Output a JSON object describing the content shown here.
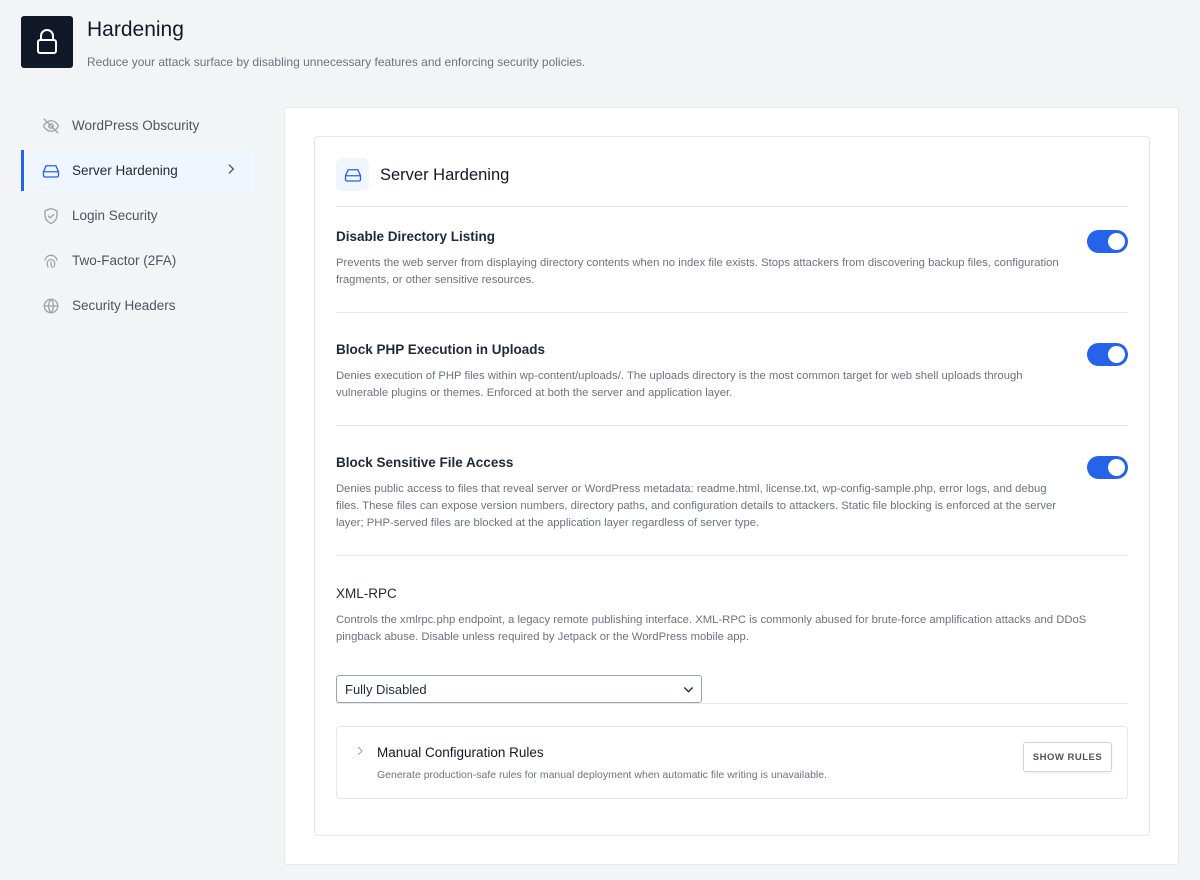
{
  "header": {
    "title": "Hardening",
    "subtitle": "Reduce your attack surface by disabling unnecessary features and enforcing security policies.",
    "logo_icon": "lock-icon"
  },
  "sidebar": {
    "items": [
      {
        "label": "WordPress Obscurity",
        "icon": "eye-slash-icon",
        "active": false
      },
      {
        "label": "Server Hardening",
        "icon": "hard-drive-icon",
        "active": true
      },
      {
        "label": "Login Security",
        "icon": "shield-check-icon",
        "active": false
      },
      {
        "label": "Two-Factor (2FA)",
        "icon": "fingerprint-icon",
        "active": false
      },
      {
        "label": "Security Headers",
        "icon": "globe-icon",
        "active": false
      }
    ]
  },
  "card": {
    "title": "Server Hardening",
    "icon": "hard-drive-icon"
  },
  "settings": [
    {
      "title": "Disable Directory Listing",
      "description": "Prevents the web server from displaying directory contents when no index file exists. Stops attackers from discovering backup files, configuration fragments, or other sensitive resources.",
      "enabled": true
    },
    {
      "title": "Block PHP Execution in Uploads",
      "description": "Denies execution of PHP files within wp-content/uploads/. The uploads directory is the most common target for web shell uploads through vulnerable plugins or themes. Enforced at both the server and application layer.",
      "enabled": true
    },
    {
      "title": "Block Sensitive File Access",
      "description": "Denies public access to files that reveal server or WordPress metadata: readme.html, license.txt, wp-config-sample.php, error logs, and debug files. These files can expose version numbers, directory paths, and configuration details to attackers. Static file blocking is enforced at the server layer; PHP-served files are blocked at the application layer regardless of server type.",
      "enabled": true
    }
  ],
  "xmlrpc": {
    "title": "XML-RPC",
    "description": "Controls the xmlrpc.php endpoint, a legacy remote publishing interface. XML-RPC is commonly abused for brute-force amplification attacks and DDoS pingback abuse. Disable unless required by Jetpack or the WordPress mobile app.",
    "selected": "Fully Disabled"
  },
  "manual_rules": {
    "title": "Manual Configuration Rules",
    "description": "Generate production-safe rules for manual deployment when automatic file writing is unavailable.",
    "button_label": "SHOW RULES"
  },
  "colors": {
    "accent": "#2563eb",
    "logo_bg": "#111827",
    "active_bg": "#eff6ff"
  }
}
